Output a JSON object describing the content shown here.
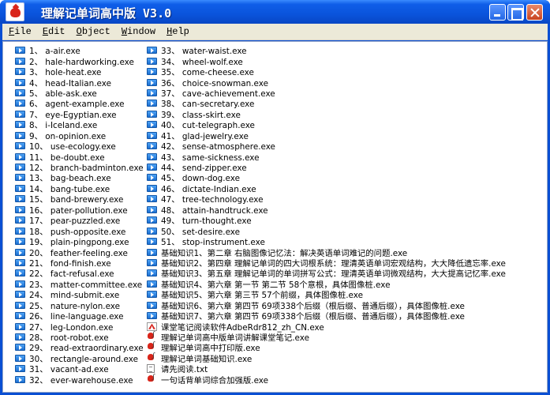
{
  "window": {
    "title": "理解记单词高中版 V3.0"
  },
  "menu": [
    {
      "label": "File",
      "accel": "F",
      "rest": "ile"
    },
    {
      "label": "Edit",
      "accel": "E",
      "rest": "dit"
    },
    {
      "label": "Object",
      "accel": "O",
      "rest": "bject"
    },
    {
      "label": "Window",
      "accel": "W",
      "rest": "indow"
    },
    {
      "label": "Help",
      "accel": "H",
      "rest": "elp"
    }
  ],
  "files_left": [
    {
      "name": "1、 a-air.exe",
      "icon": "exe-icon"
    },
    {
      "name": "2、 hale-hardworking.exe",
      "icon": "exe-icon"
    },
    {
      "name": "3、 hole-heat.exe",
      "icon": "exe-icon"
    },
    {
      "name": "4、 head-Italian.exe",
      "icon": "exe-icon"
    },
    {
      "name": "5、 able-ask.exe",
      "icon": "exe-icon"
    },
    {
      "name": "6、 agent-example.exe",
      "icon": "exe-icon"
    },
    {
      "name": "7、 eye-Egyptian.exe",
      "icon": "exe-icon"
    },
    {
      "name": "8、 i-Iceland.exe",
      "icon": "exe-icon"
    },
    {
      "name": "9、 on-opinion.exe",
      "icon": "exe-icon"
    },
    {
      "name": "10、 use-ecology.exe",
      "icon": "exe-icon"
    },
    {
      "name": "11、 be-doubt.exe",
      "icon": "exe-icon"
    },
    {
      "name": "12、 branch-badminton.exe",
      "icon": "exe-icon"
    },
    {
      "name": "13、 bag-beach.exe",
      "icon": "exe-icon"
    },
    {
      "name": "14、 bang-tube.exe",
      "icon": "exe-icon"
    },
    {
      "name": "15、 band-brewery.exe",
      "icon": "exe-icon"
    },
    {
      "name": "16、 pater-pollution.exe",
      "icon": "exe-icon"
    },
    {
      "name": "17、 pear-puzzled.exe",
      "icon": "exe-icon"
    },
    {
      "name": "18、 push-opposite.exe",
      "icon": "exe-icon"
    },
    {
      "name": "19、 plain-pingpong.exe",
      "icon": "exe-icon"
    },
    {
      "name": "20、 feather-feeling.exe",
      "icon": "exe-icon"
    },
    {
      "name": "21、 fond-finish.exe",
      "icon": "exe-icon"
    },
    {
      "name": "22、 fact-refusal.exe",
      "icon": "exe-icon"
    },
    {
      "name": "23、 matter-committee.exe",
      "icon": "exe-icon"
    },
    {
      "name": "24、 mind-submit.exe",
      "icon": "exe-icon"
    },
    {
      "name": "25、 nature-nylon.exe",
      "icon": "exe-icon"
    },
    {
      "name": "26、 line-language.exe",
      "icon": "exe-icon"
    },
    {
      "name": "27、 leg-London.exe",
      "icon": "exe-icon"
    },
    {
      "name": "28、 root-robot.exe",
      "icon": "exe-icon"
    },
    {
      "name": "29、 read-extraordinary.exe",
      "icon": "exe-icon"
    },
    {
      "name": "30、 rectangle-around.exe",
      "icon": "exe-icon"
    },
    {
      "name": "31、 vacant-ad.exe",
      "icon": "exe-icon"
    },
    {
      "name": "32、 ever-warehouse.exe",
      "icon": "exe-icon"
    }
  ],
  "files_right": [
    {
      "name": "33、 water-waist.exe",
      "icon": "exe-icon"
    },
    {
      "name": "34、 wheel-wolf.exe",
      "icon": "exe-icon"
    },
    {
      "name": "35、 come-cheese.exe",
      "icon": "exe-icon"
    },
    {
      "name": "36、 choice-snowman.exe",
      "icon": "exe-icon"
    },
    {
      "name": "37、 cave-achievement.exe",
      "icon": "exe-icon"
    },
    {
      "name": "38、 can-secretary.exe",
      "icon": "exe-icon"
    },
    {
      "name": "39、 class-skirt.exe",
      "icon": "exe-icon"
    },
    {
      "name": "40、 cut-telegraph.exe",
      "icon": "exe-icon"
    },
    {
      "name": "41、 glad-jewelry.exe",
      "icon": "exe-icon"
    },
    {
      "name": "42、 sense-atmosphere.exe",
      "icon": "exe-icon"
    },
    {
      "name": "43、 same-sickness.exe",
      "icon": "exe-icon"
    },
    {
      "name": "44、 send-zipper.exe",
      "icon": "exe-icon"
    },
    {
      "name": "45、 down-dog.exe",
      "icon": "exe-icon"
    },
    {
      "name": "46、 dictate-Indian.exe",
      "icon": "exe-icon"
    },
    {
      "name": "47、 tree-technology.exe",
      "icon": "exe-icon"
    },
    {
      "name": "48、 attain-handtruck.exe",
      "icon": "exe-icon"
    },
    {
      "name": "49、 turn-thought.exe",
      "icon": "exe-icon"
    },
    {
      "name": "50、 set-desire.exe",
      "icon": "exe-icon"
    },
    {
      "name": "51、 stop-instrument.exe",
      "icon": "exe-icon"
    },
    {
      "name": "基础知识1、第二章 右脑图像记忆法：解决英语单词难记的问题.exe",
      "icon": "exe-icon"
    },
    {
      "name": "基础知识2、第四章 理解记单词的四大词根系统：理清英语单词宏观结构，大大降低遗忘率.exe",
      "icon": "exe-icon"
    },
    {
      "name": "基础知识3、第五章 理解记单词的单词拼写公式：理清英语单词微观结构，大大提高记忆率.exe",
      "icon": "exe-icon"
    },
    {
      "name": "基础知识4、第六章 第一节 第二节 58个意根，具体图像桩.exe",
      "icon": "exe-icon"
    },
    {
      "name": "基础知识5、第六章 第三节 57个前缀，具体图像桩.exe",
      "icon": "exe-icon"
    },
    {
      "name": "基础知识6、第六章 第四节 69项338个后缀（根后缀、普通后缀），具体图像桩.exe",
      "icon": "exe-icon"
    },
    {
      "name": "基础知识7、第六章 第四节 69项338个后缀（根后缀、普通后缀），具体图像桩.exe",
      "icon": "exe-icon"
    },
    {
      "name": "课堂笔记阅读软件AdbeRdr812_zh_CN.exe",
      "icon": "pdf-icon"
    },
    {
      "name": "理解记单词高中版单词讲解课堂笔记.exe",
      "icon": "app-icon"
    },
    {
      "name": "理解记单词高中打印版.exe",
      "icon": "app-icon"
    },
    {
      "name": "理解记单词基础知识.exe",
      "icon": "app-icon"
    },
    {
      "name": "请先阅读.txt",
      "icon": "txt-icon"
    },
    {
      "name": "一句话背单词综合加强版.exe",
      "icon": "app-icon"
    }
  ]
}
